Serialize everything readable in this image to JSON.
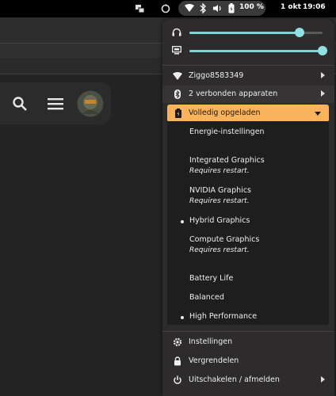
{
  "topbar": {
    "battery_percent": "100 %",
    "date": "1 okt",
    "time": "19:06"
  },
  "sliders": [
    {
      "name": "volume",
      "icon": "headphones-icon",
      "level": 0.83
    },
    {
      "name": "brightness",
      "icon": "display-brightness-icon",
      "level": 1.0
    }
  ],
  "menu": {
    "wifi_label": "Ziggo8583349",
    "bluetooth_label": "2 verbonden apparaten",
    "battery_label": "Volledig opgeladen",
    "power_settings_label": "Energie-instellingen",
    "graphics": [
      {
        "label": "Integrated Graphics",
        "note": "Requires restart.",
        "selected": false
      },
      {
        "label": "NVIDIA Graphics",
        "note": "Requires restart.",
        "selected": false
      },
      {
        "label": "Hybrid Graphics",
        "note": "",
        "selected": true
      },
      {
        "label": "Compute Graphics",
        "note": "Requires restart.",
        "selected": false
      }
    ],
    "power_profiles": [
      {
        "label": "Battery Life",
        "selected": false
      },
      {
        "label": "Balanced",
        "selected": false
      },
      {
        "label": "High Performance",
        "selected": true
      }
    ],
    "settings_label": "Instellingen",
    "lock_label": "Vergrendelen",
    "power_off_label": "Uitschakelen / afmelden"
  },
  "colors": {
    "accent": "#f8b35c",
    "slider": "#7fd3d3",
    "menu_bg": "#2d2b2b"
  }
}
